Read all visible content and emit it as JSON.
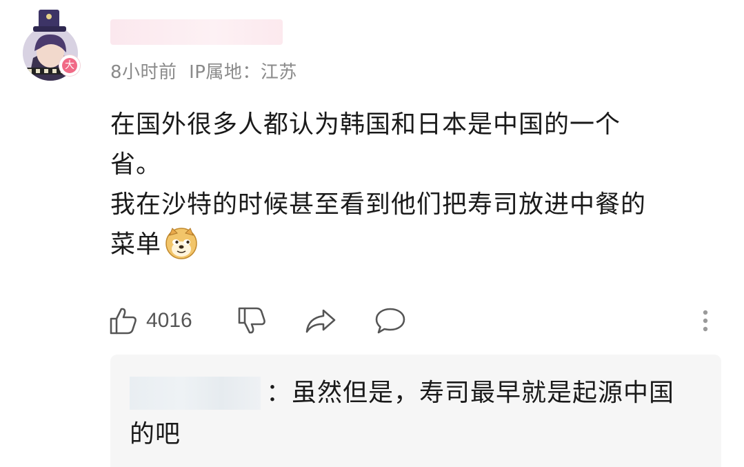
{
  "comment": {
    "avatar_icon": "user-avatar",
    "level_badge": "大",
    "meta": "8小时前  IP属地：江苏",
    "content_lines": [
      "在国外很多人都认为韩国和日本是中国的一个",
      "省。",
      "我在沙特的时候甚至看到他们把寿司放进中餐的",
      "菜单"
    ],
    "emoji": "doge-icon"
  },
  "actions": {
    "like_count": "4016"
  },
  "reply": {
    "text_line1": "：虽然但是，寿司最早就是起源中国",
    "text_line2": "的吧"
  }
}
